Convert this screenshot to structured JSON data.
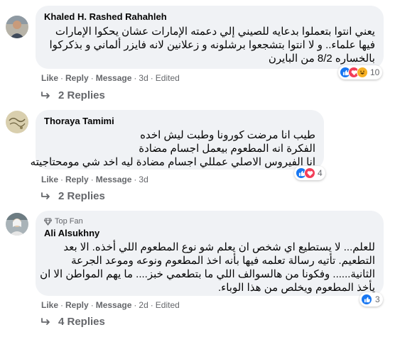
{
  "comments": [
    {
      "author": "Khaled H. Rashed Rahahleh",
      "lines": [
        "يعني انتوا بتعملوا بدعايه للصيني إلي دعمته الإمارات عشان يحكوا الإمارات",
        "فيها علماء.. و لا انتوا بتشجعوا برشلونه و زعلانين لانه فايزر ألماني و بذكركوا",
        "بالخساره 8/2 من البايرن"
      ],
      "reaction_count": "10",
      "actions": {
        "like": "Like",
        "reply": "Reply",
        "message": "Message",
        "time": "3d",
        "edited": "Edited"
      },
      "replies": "2 Replies"
    },
    {
      "author": "Thoraya Tamimi",
      "lines": [
        "طيب انا مرضت كورونا وطبت ليش اخده",
        "الفكرة انه المطعوم بيعمل اجسام مضادة",
        "انا الفيروس الاصلي عمللي اجسام مضادة ليه اخد شي مومحتاجيته"
      ],
      "reaction_count": "4",
      "actions": {
        "like": "Like",
        "reply": "Reply",
        "message": "Message",
        "time": "3d"
      },
      "replies": "2 Replies"
    },
    {
      "badge": "Top Fan",
      "author": "Ali Alsukhny",
      "lines": [
        "للعلم... لا يستطيع اي شخص ان يعلم شو نوع المطعوم اللي أخذه. الا بعد",
        "التطعيم. تأتيه رسالة تعلمه فيها بأنه اخذ المطعوم ونوعه وموعد الجرعة",
        "الثانية...... وفكونا من هالسوالف اللي ما بتطعمي خبز.... ما يهم المواطن الا ان",
        "يأخذ المطعوم ويخلص من هذا الوباء."
      ],
      "reaction_count": "3",
      "actions": {
        "like": "Like",
        "reply": "Reply",
        "message": "Message",
        "time": "2d",
        "edited": "Edited"
      },
      "replies": "4 Replies"
    }
  ],
  "colors": {
    "bubble": "#f0f2f5",
    "secondary_text": "#65676b",
    "like_blue": "#1877f2",
    "love_red": "#f33e58",
    "haha_yellow": "#f7b125"
  },
  "icons": [
    "like-icon",
    "love-icon",
    "haha-icon",
    "reply-arrow-icon",
    "top-fan-icon"
  ]
}
